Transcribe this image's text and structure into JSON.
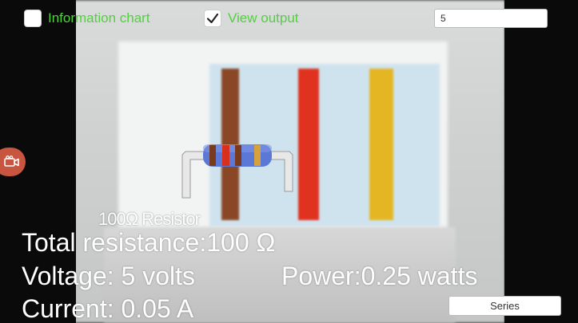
{
  "header": {
    "info_chart_label": "Information chart",
    "info_chart_checked": false,
    "view_output_label": "View output",
    "view_output_checked": true,
    "voltage_input_value": "5"
  },
  "resistor": {
    "label": "100Ω Resistor",
    "band_colors": [
      "#7a3a1e",
      "#d8301e",
      "#7a3a1e",
      "#d8a23a"
    ]
  },
  "readouts": {
    "total_resistance": "Total resistance:100 Ω",
    "voltage": "Voltage: 5 volts",
    "power": "Power:0.25 watts",
    "current": "Current: 0.05 A"
  },
  "buttons": {
    "series_label": "Series"
  },
  "colors": {
    "label_green": "#4fd23a",
    "camera_button": "#c8553f",
    "resistor_body": "#5b78d6"
  },
  "icons": {
    "camera": "video-camera-icon",
    "check": "checkmark-icon"
  }
}
